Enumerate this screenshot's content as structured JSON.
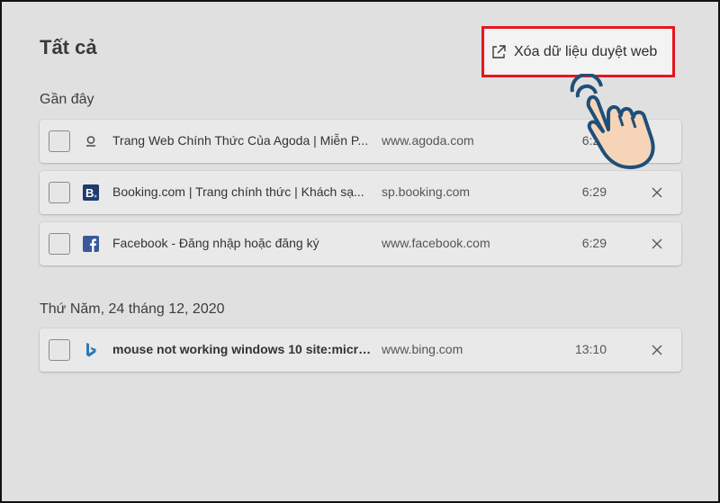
{
  "header": {
    "title": "Tất cả",
    "clear_label": "Xóa dữ liệu duyệt web",
    "clear_icon": "external-link-icon"
  },
  "sections": [
    {
      "heading": "Gần đây",
      "items": [
        {
          "title": "Trang Web Chính Thức Của Agoda | Miễn P...",
          "domain": "www.agoda.com",
          "time": "6:29",
          "icon": "agoda-icon"
        },
        {
          "title": "Booking.com | Trang chính thức | Khách sạ...",
          "domain": "sp.booking.com",
          "time": "6:29",
          "icon": "booking-icon"
        },
        {
          "title": "Facebook - Đăng nhập hoặc đăng ký",
          "domain": "www.facebook.com",
          "time": "6:29",
          "icon": "facebook-icon"
        }
      ]
    },
    {
      "heading": "Thứ Năm, 24 tháng 12, 2020",
      "items": [
        {
          "title": "mouse not working windows 10 site:micros...",
          "domain": "www.bing.com",
          "time": "13:10",
          "icon": "bing-icon"
        }
      ]
    }
  ],
  "colors": {
    "highlight_border": "#e4171e",
    "page_background": "#e0e0e0",
    "booking_brand": "#1f3a6b",
    "facebook_brand": "#3b5998",
    "bing_brand": "#2a7ab8"
  },
  "overlay": {
    "pointer_icon": "hand-pointer-icon"
  }
}
